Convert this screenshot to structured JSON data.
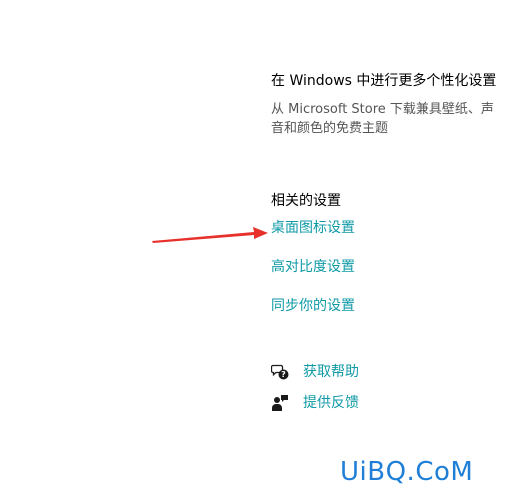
{
  "colors": {
    "link": "#0f9aa6",
    "text": "#000000",
    "muted": "#555555",
    "arrow": "#e8302a",
    "watermark": "#1f7fd6"
  },
  "personalize": {
    "title": "在 Windows 中进行更多个性化设置",
    "description": "从 Microsoft Store 下载兼具壁纸、声音和颜色的免费主题"
  },
  "related": {
    "title": "相关的设置",
    "links": [
      {
        "label": "桌面图标设置"
      },
      {
        "label": "高对比度设置"
      },
      {
        "label": "同步你的设置"
      }
    ]
  },
  "help": {
    "get_help": {
      "label": "获取帮助",
      "icon": "chat-help-icon"
    },
    "feedback": {
      "label": "提供反馈",
      "icon": "feedback-person-icon"
    }
  },
  "annotation": {
    "arrow": "red-arrow-icon"
  },
  "watermark": {
    "text": "UiBQ.CoM"
  }
}
